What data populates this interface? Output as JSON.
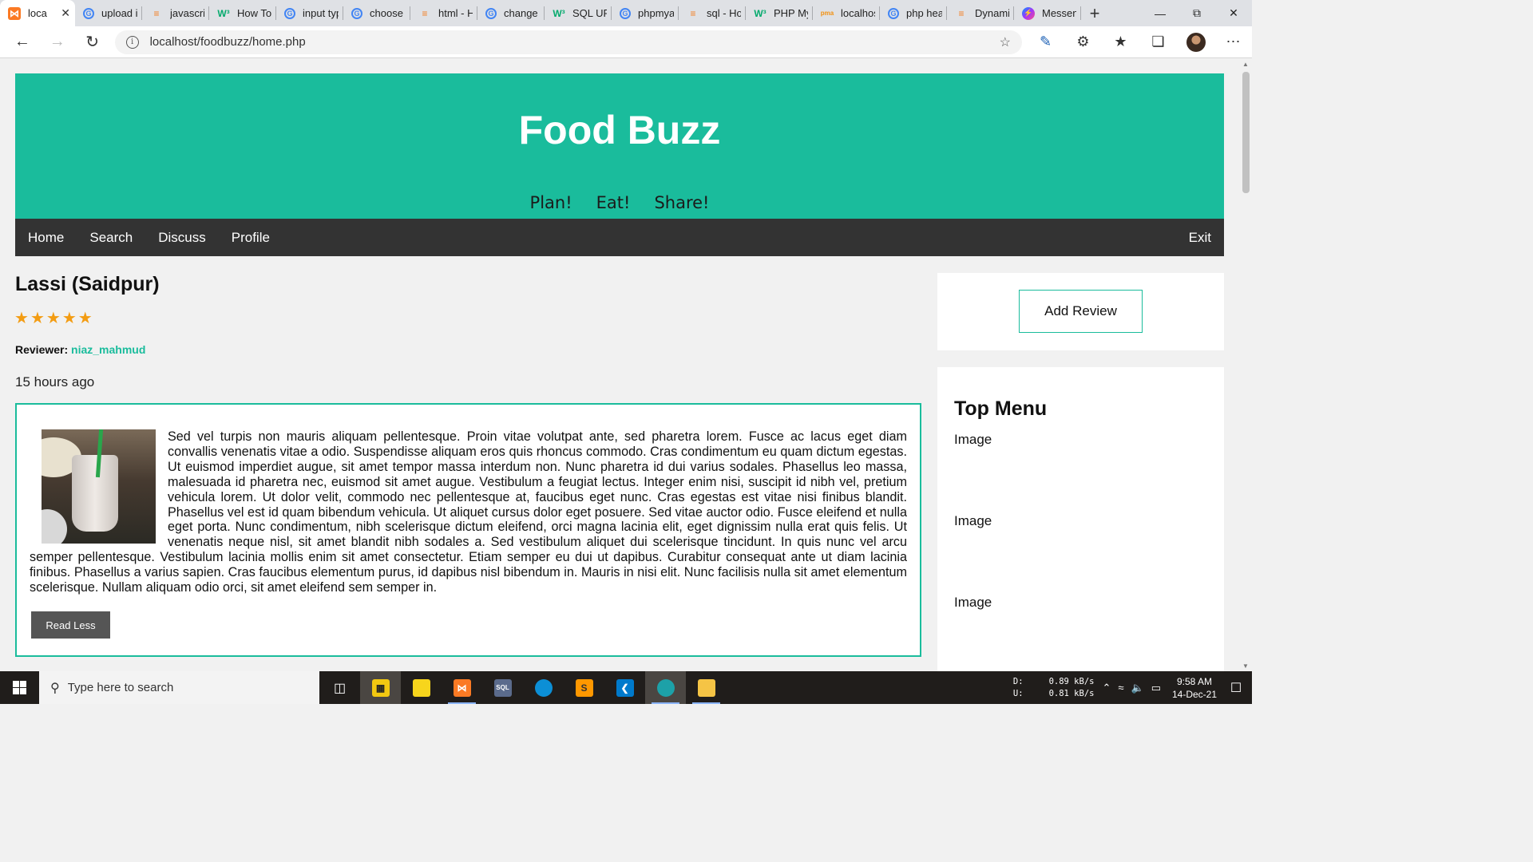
{
  "browser": {
    "tabs": [
      {
        "title": "loca",
        "icon": "xampp-icon",
        "active": true
      },
      {
        "title": "upload i",
        "icon": "google-icon"
      },
      {
        "title": "javascrip",
        "icon": "stackoverflow-icon"
      },
      {
        "title": "How To",
        "icon": "w3schools-icon"
      },
      {
        "title": "input typ",
        "icon": "google-icon"
      },
      {
        "title": "choose f",
        "icon": "google-icon"
      },
      {
        "title": "html - H",
        "icon": "stackoverflow-icon"
      },
      {
        "title": "change",
        "icon": "google-icon"
      },
      {
        "title": "SQL UPD",
        "icon": "w3schools-icon"
      },
      {
        "title": "phpmya",
        "icon": "google-icon"
      },
      {
        "title": "sql - Ho",
        "icon": "stackoverflow-icon"
      },
      {
        "title": "PHP My",
        "icon": "w3schools-icon"
      },
      {
        "title": "localhos",
        "icon": "phpmyadmin-icon"
      },
      {
        "title": "php hea",
        "icon": "google-icon"
      },
      {
        "title": "Dynamic",
        "icon": "stackoverflow-icon"
      },
      {
        "title": "Messeng",
        "icon": "messenger-icon"
      }
    ],
    "url": "localhost/foodbuzz/home.php"
  },
  "site": {
    "title": "Food Buzz",
    "slogans": [
      "Plan!",
      "Eat!",
      "Share!"
    ],
    "nav": {
      "home": "Home",
      "search": "Search",
      "discuss": "Discuss",
      "profile": "Profile",
      "exit": "Exit"
    }
  },
  "review": {
    "title": "Lassi (Saidpur)",
    "rating": 5,
    "reviewer_label": "Reviewer:",
    "reviewer_name": "niaz_mahmud",
    "time_ago": "15 hours ago",
    "body": "Sed vel turpis non mauris aliquam pellentesque. Proin vitae volutpat ante, sed pharetra lorem. Fusce ac lacus eget diam convallis venenatis vitae a odio. Suspendisse aliquam eros quis rhoncus commodo. Cras condimentum eu quam dictum egestas. Ut euismod imperdiet augue, sit amet tempor massa interdum non. Nunc pharetra id dui varius sodales. Phasellus leo massa, malesuada id pharetra nec, euismod sit amet augue. Vestibulum a feugiat lectus. Integer enim nisi, suscipit id nibh vel, pretium vehicula lorem. Ut dolor velit, commodo nec pellentesque at, faucibus eget nunc. Cras egestas est vitae nisi finibus blandit. Phasellus vel est id quam bibendum vehicula. Ut aliquet cursus dolor eget posuere. Sed vitae auctor odio. Fusce eleifend et nulla eget porta. Nunc condimentum, nibh scelerisque dictum eleifend, orci magna lacinia elit, eget dignissim nulla erat quis felis. Ut venenatis neque nisl, sit amet blandit nibh sodales a. Sed vestibulum aliquet dui scelerisque tincidunt. In quis nunc vel arcu semper pellentesque. Vestibulum lacinia mollis enim sit amet consectetur. Etiam semper eu dui ut dapibus. Curabitur consequat ante ut diam lacinia finibus. Phasellus a varius sapien. Cras faucibus elementum purus, id dapibus nisl bibendum in. Mauris in nisi elit. Nunc facilisis nulla sit amet elementum scelerisque. Nullam aliquam odio orci, sit amet eleifend sem semper in.",
    "read_less_label": "Read Less"
  },
  "sidebar": {
    "add_review_label": "Add Review",
    "top_menu_title": "Top Menu",
    "items": [
      "Image",
      "Image",
      "Image"
    ]
  },
  "taskbar": {
    "search_placeholder": "Type here to search",
    "net_labels": [
      "D:",
      "U:"
    ],
    "net_rates": [
      "0.89 kB/s",
      "0.81 kB/s"
    ],
    "time": "9:58 AM",
    "date": "14-Dec-21"
  },
  "colors": {
    "accent": "#1abc9c",
    "navbar": "#333333",
    "star": "#f39c12"
  }
}
